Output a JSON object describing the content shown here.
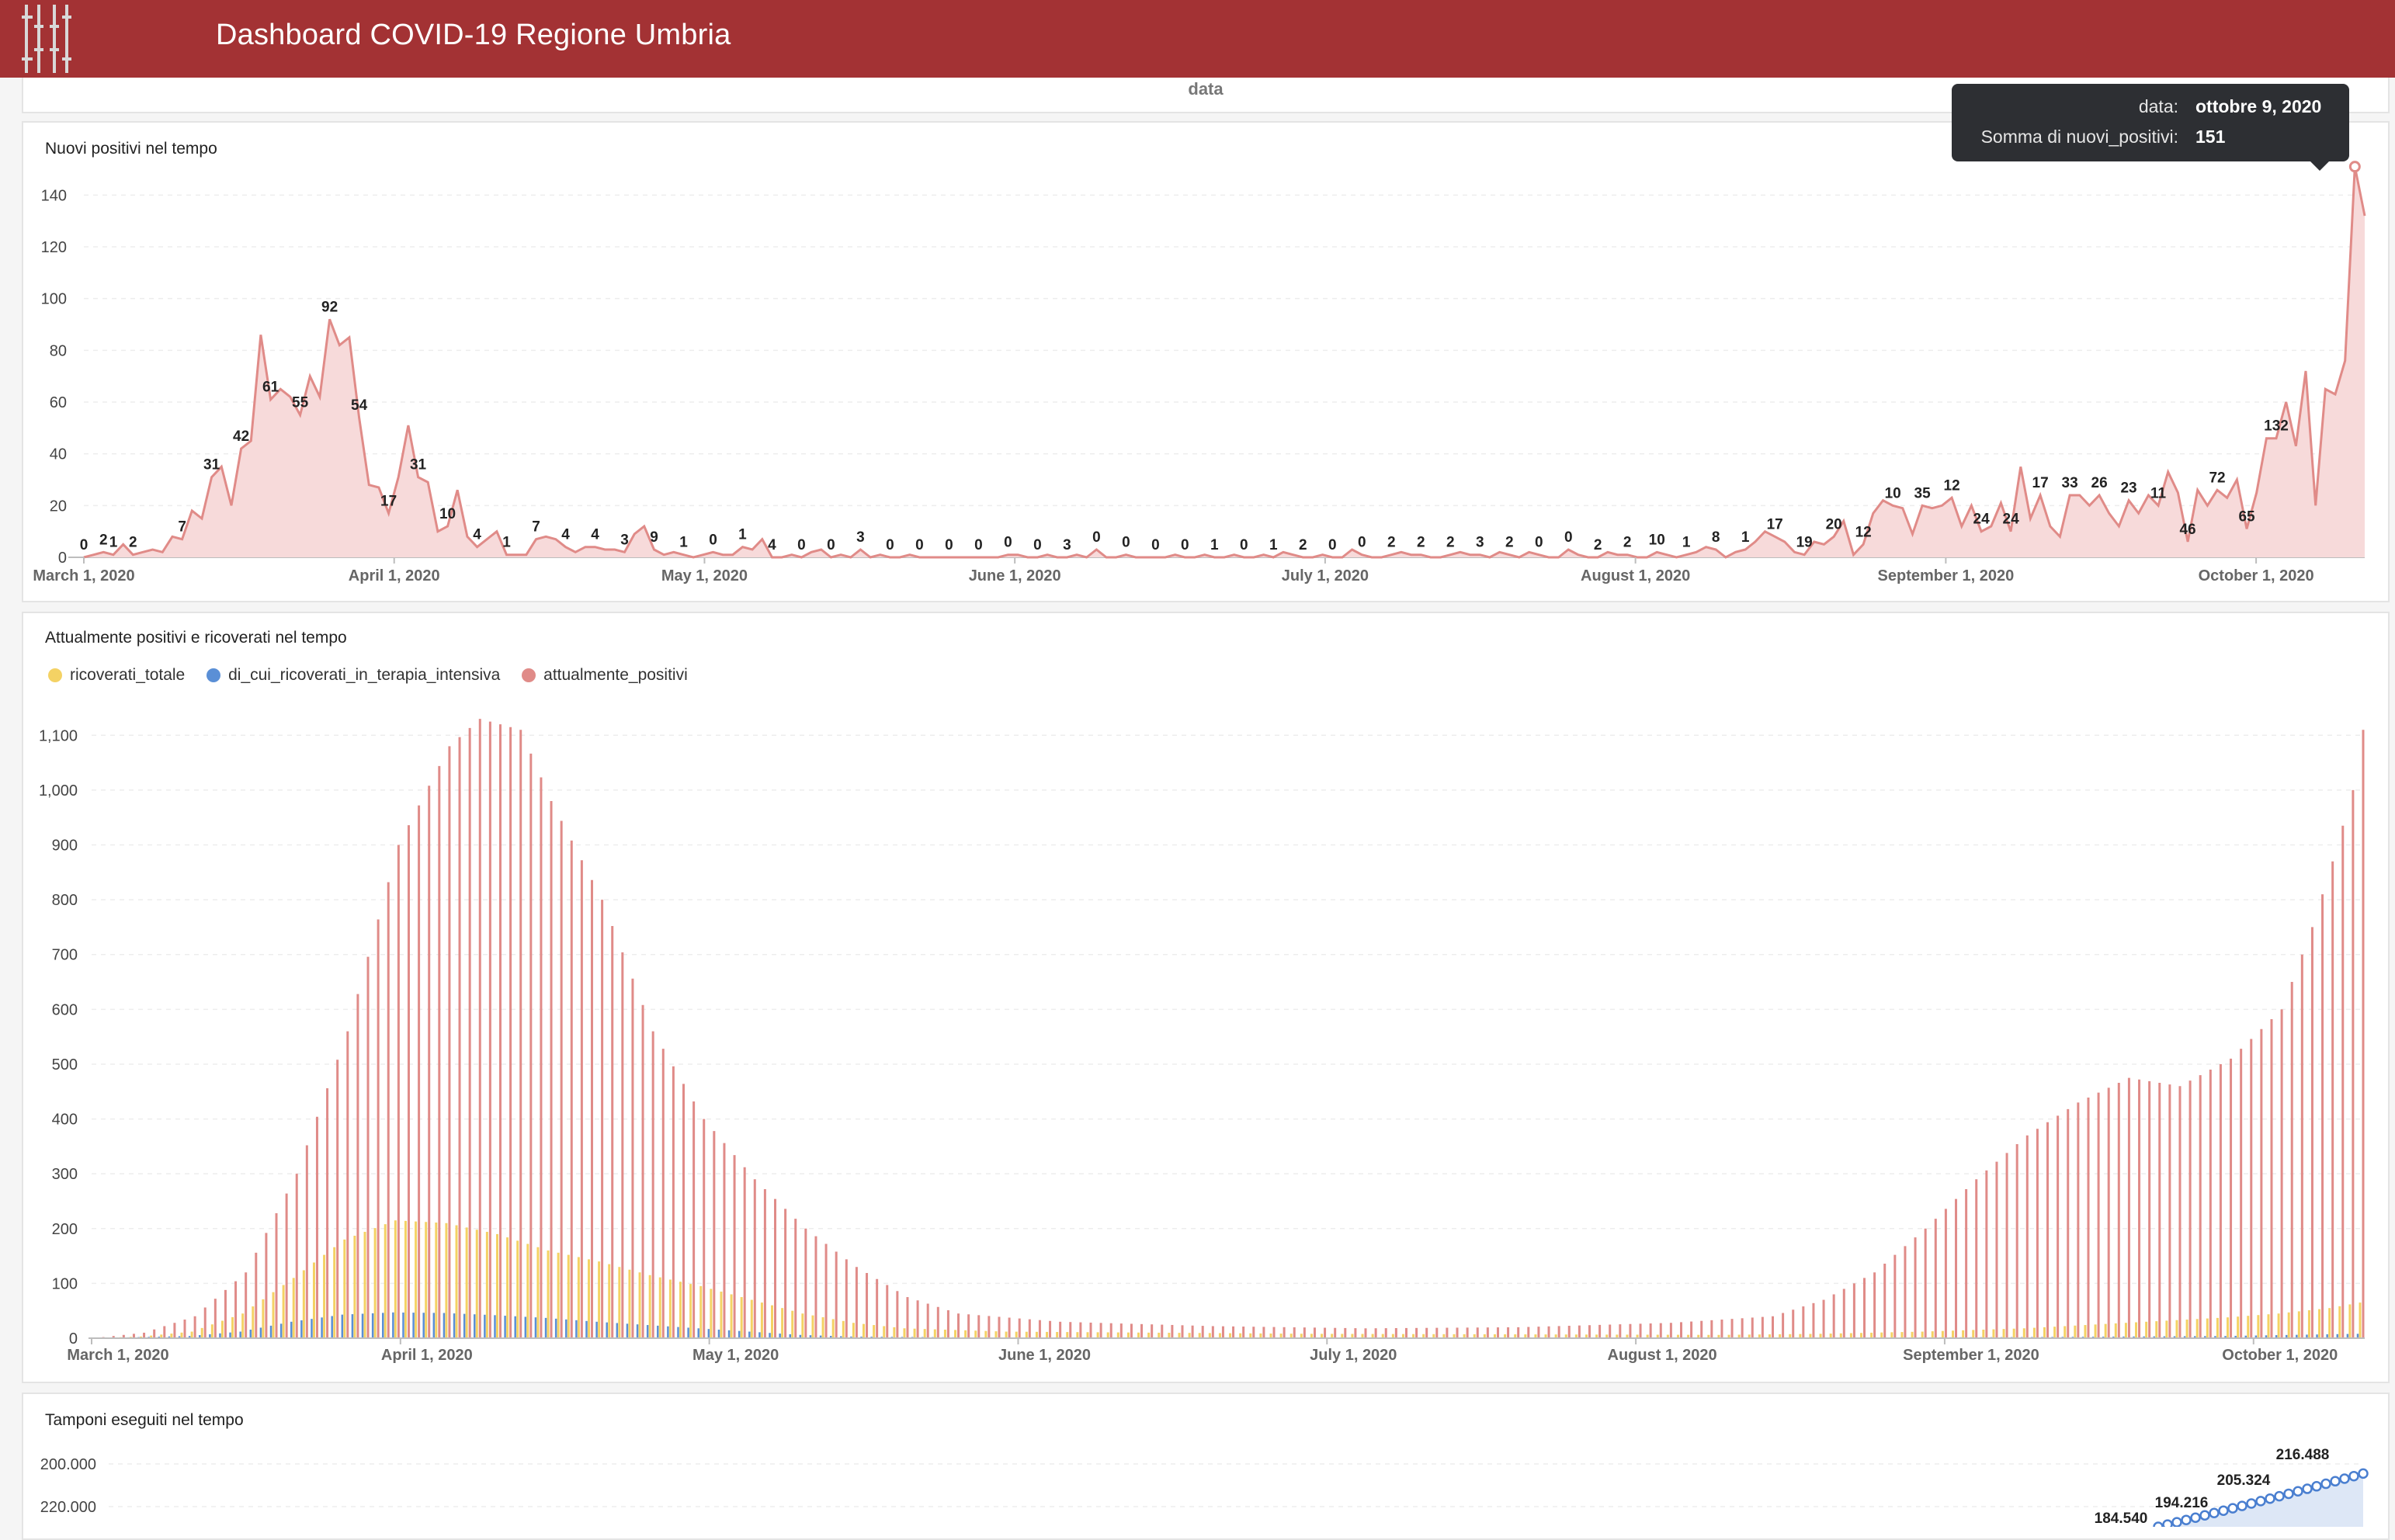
{
  "header": {
    "title": "Dashboard COVID-19 Regione Umbria",
    "logo_icon": "umbria-logo-icon"
  },
  "top_strip": {
    "axis_label": "data"
  },
  "tooltip": {
    "rows": [
      {
        "key": "data:",
        "value": "ottobre 9, 2020"
      },
      {
        "key": "Somma di nuovi_positivi:",
        "value": "151"
      }
    ]
  },
  "colors": {
    "header": "#a33234",
    "positivi": "#e08b88",
    "positivi_fill": "#f7dada",
    "ricoverati": "#f4d264",
    "terapia": "#5a8fd6",
    "tamponi": "#4a7fd0"
  },
  "panels": {
    "nuovi": {
      "title": "Nuovi positivi nel tempo"
    },
    "attuali": {
      "title": "Attualmente positivi e ricoverati nel tempo"
    },
    "tamponi": {
      "title": "Tamponi eseguiti nel tempo"
    }
  },
  "chart_data": [
    {
      "type": "area",
      "title": "Nuovi positivi nel tempo",
      "x_ticks": [
        "March 1, 2020",
        "April 1, 2020",
        "May 1, 2020",
        "June 1, 2020",
        "July 1, 2020",
        "August 1, 2020",
        "September 1, 2020",
        "October 1, 2020"
      ],
      "y_ticks": [
        "0",
        "20",
        "40",
        "60",
        "80",
        "100",
        "120",
        "140"
      ],
      "ylim": [
        0,
        150
      ],
      "series": [
        {
          "values": [
            0,
            1,
            2,
            1,
            5,
            1,
            2,
            3,
            2,
            8,
            7,
            18,
            15,
            31,
            35,
            20,
            42,
            45,
            86,
            61,
            65,
            62,
            55,
            70,
            62,
            92,
            82,
            85,
            54,
            28,
            27,
            17,
            31,
            51,
            31,
            29,
            10,
            12,
            26,
            8,
            4,
            7,
            10,
            1,
            1,
            1,
            7,
            8,
            7,
            4,
            2,
            4,
            4,
            3,
            3,
            2,
            9,
            12,
            3,
            1,
            2,
            1,
            0,
            1,
            2,
            1,
            1,
            4,
            3,
            7,
            0,
            0,
            1,
            0,
            2,
            3,
            0,
            1,
            0,
            3,
            0,
            1,
            0,
            0,
            1,
            0,
            0,
            0,
            0,
            0,
            0,
            0,
            0,
            0,
            1,
            1,
            0,
            0,
            1,
            0,
            0,
            1,
            0,
            3,
            0,
            0,
            1,
            0,
            0,
            0,
            0,
            1,
            0,
            0,
            1,
            0,
            0,
            1,
            0,
            0,
            1,
            0,
            2,
            1,
            0,
            0,
            1,
            0,
            0,
            3,
            1,
            0,
            0,
            1,
            2,
            1,
            1,
            0,
            0,
            1,
            2,
            1,
            1,
            0,
            2,
            1,
            0,
            2,
            1,
            0,
            0,
            3,
            1,
            0,
            0,
            2,
            1,
            1,
            0,
            0,
            2,
            1,
            0,
            1,
            2,
            4,
            3,
            0,
            2,
            3,
            6,
            10,
            8,
            6,
            2,
            1,
            6,
            5,
            8,
            14,
            1,
            5,
            17,
            22,
            20,
            19,
            9,
            20,
            19,
            20,
            23,
            12,
            20,
            10,
            12,
            21,
            10,
            35,
            15,
            24,
            12,
            8,
            24,
            24,
            20,
            24,
            17,
            12,
            22,
            17,
            24,
            20,
            33,
            25,
            6,
            26,
            20,
            26,
            23,
            30,
            11,
            25,
            46,
            46,
            60,
            43,
            72,
            20,
            65,
            63,
            76,
            151,
            132
          ]
        }
      ],
      "data_labels": [
        {
          "x": 0,
          "label": "0"
        },
        {
          "x": 2,
          "label": "2"
        },
        {
          "x": 3,
          "label": "1"
        },
        {
          "x": 5,
          "label": "2"
        },
        {
          "x": 10,
          "label": "7"
        },
        {
          "x": 13,
          "label": "31"
        },
        {
          "x": 16,
          "label": "42"
        },
        {
          "x": 19,
          "label": "61"
        },
        {
          "x": 22,
          "label": "55"
        },
        {
          "x": 25,
          "label": "92"
        },
        {
          "x": 28,
          "label": "54"
        },
        {
          "x": 31,
          "label": "17"
        },
        {
          "x": 34,
          "label": "31"
        },
        {
          "x": 37,
          "label": "10"
        },
        {
          "x": 40,
          "label": "4"
        },
        {
          "x": 43,
          "label": "1"
        },
        {
          "x": 46,
          "label": "7"
        },
        {
          "x": 49,
          "label": "4"
        },
        {
          "x": 52,
          "label": "4"
        },
        {
          "x": 55,
          "label": "3"
        },
        {
          "x": 58,
          "label": "9"
        },
        {
          "x": 61,
          "label": "1"
        },
        {
          "x": 64,
          "label": "0"
        },
        {
          "x": 67,
          "label": "1"
        },
        {
          "x": 70,
          "label": "4"
        },
        {
          "x": 73,
          "label": "0"
        },
        {
          "x": 76,
          "label": "0"
        },
        {
          "x": 79,
          "label": "3"
        },
        {
          "x": 82,
          "label": "0"
        },
        {
          "x": 85,
          "label": "0"
        },
        {
          "x": 88,
          "label": "0"
        },
        {
          "x": 91,
          "label": "0"
        },
        {
          "x": 94,
          "label": "0"
        },
        {
          "x": 97,
          "label": "0"
        },
        {
          "x": 100,
          "label": "3"
        },
        {
          "x": 103,
          "label": "0"
        },
        {
          "x": 106,
          "label": "0"
        },
        {
          "x": 109,
          "label": "0"
        },
        {
          "x": 112,
          "label": "0"
        },
        {
          "x": 115,
          "label": "1"
        },
        {
          "x": 118,
          "label": "0"
        },
        {
          "x": 121,
          "label": "1"
        },
        {
          "x": 124,
          "label": "2"
        },
        {
          "x": 127,
          "label": "0"
        },
        {
          "x": 130,
          "label": "0"
        },
        {
          "x": 133,
          "label": "2"
        },
        {
          "x": 136,
          "label": "2"
        },
        {
          "x": 139,
          "label": "2"
        },
        {
          "x": 142,
          "label": "3"
        },
        {
          "x": 145,
          "label": "2"
        },
        {
          "x": 148,
          "label": "0"
        },
        {
          "x": 151,
          "label": "0"
        },
        {
          "x": 154,
          "label": "2"
        },
        {
          "x": 157,
          "label": "2"
        },
        {
          "x": 160,
          "label": "10"
        },
        {
          "x": 163,
          "label": "1"
        },
        {
          "x": 166,
          "label": "8"
        },
        {
          "x": 169,
          "label": "1"
        },
        {
          "x": 172,
          "label": "17"
        },
        {
          "x": 175,
          "label": "19"
        },
        {
          "x": 178,
          "label": "20"
        },
        {
          "x": 181,
          "label": "12"
        },
        {
          "x": 184,
          "label": "10"
        },
        {
          "x": 187,
          "label": "35"
        },
        {
          "x": 190,
          "label": "12"
        },
        {
          "x": 193,
          "label": "24"
        },
        {
          "x": 196,
          "label": "24"
        },
        {
          "x": 199,
          "label": "17"
        },
        {
          "x": 202,
          "label": "33"
        },
        {
          "x": 205,
          "label": "26"
        },
        {
          "x": 208,
          "label": "23"
        },
        {
          "x": 211,
          "label": "11"
        },
        {
          "x": 214,
          "label": "46"
        },
        {
          "x": 217,
          "label": "72"
        },
        {
          "x": 220,
          "label": "65"
        },
        {
          "x": 223,
          "label": "132"
        }
      ]
    },
    {
      "type": "bar",
      "title": "Attualmente positivi e ricoverati nel tempo",
      "x_ticks": [
        "March 1, 2020",
        "April 1, 2020",
        "May 1, 2020",
        "June 1, 2020",
        "July 1, 2020",
        "August 1, 2020",
        "September 1, 2020",
        "October 1, 2020"
      ],
      "y_ticks": [
        "0",
        "100",
        "200",
        "300",
        "400",
        "500",
        "600",
        "700",
        "800",
        "900",
        "1,000",
        "1,100"
      ],
      "ylim": [
        0,
        1150
      ],
      "legend": [
        "ricoverati_totale",
        "di_cui_ricoverati_in_terapia_intensiva",
        "attualmente_positivi"
      ],
      "legend_position": "top-left",
      "series": [
        {
          "name": "attualmente_positivi",
          "key_points": [
            [
              0,
              0
            ],
            [
              5,
              10
            ],
            [
              10,
              40
            ],
            [
              15,
              120
            ],
            [
              20,
              300
            ],
            [
              25,
              560
            ],
            [
              30,
              900
            ],
            [
              35,
              1080
            ],
            [
              38,
              1130
            ],
            [
              42,
              1110
            ],
            [
              45,
              980
            ],
            [
              50,
              800
            ],
            [
              55,
              560
            ],
            [
              60,
              400
            ],
            [
              65,
              290
            ],
            [
              70,
              200
            ],
            [
              75,
              130
            ],
            [
              80,
              75
            ],
            [
              85,
              45
            ],
            [
              95,
              30
            ],
            [
              110,
              22
            ],
            [
              125,
              18
            ],
            [
              140,
              20
            ],
            [
              155,
              28
            ],
            [
              165,
              40
            ],
            [
              170,
              70
            ],
            [
              175,
              120
            ],
            [
              180,
              200
            ],
            [
              185,
              290
            ],
            [
              190,
              370
            ],
            [
              195,
              430
            ],
            [
              200,
              475
            ],
            [
              205,
              460
            ],
            [
              210,
              510
            ],
            [
              215,
              600
            ],
            [
              218,
              750
            ],
            [
              220,
              870
            ],
            [
              222,
              1000
            ],
            [
              223,
              1110
            ]
          ]
        },
        {
          "name": "ricoverati_totale",
          "key_points": [
            [
              0,
              0
            ],
            [
              5,
              3
            ],
            [
              10,
              12
            ],
            [
              15,
              45
            ],
            [
              20,
              110
            ],
            [
              25,
              180
            ],
            [
              30,
              215
            ],
            [
              35,
              210
            ],
            [
              40,
              190
            ],
            [
              45,
              160
            ],
            [
              50,
              140
            ],
            [
              55,
              115
            ],
            [
              60,
              95
            ],
            [
              65,
              70
            ],
            [
              70,
              45
            ],
            [
              75,
              28
            ],
            [
              80,
              18
            ],
            [
              90,
              12
            ],
            [
              120,
              8
            ],
            [
              160,
              6
            ],
            [
              170,
              8
            ],
            [
              180,
              12
            ],
            [
              190,
              18
            ],
            [
              200,
              28
            ],
            [
              210,
              38
            ],
            [
              215,
              45
            ],
            [
              220,
              55
            ],
            [
              223,
              65
            ]
          ]
        },
        {
          "name": "di_cui_ricoverati_in_terapia_intensiva",
          "key_points": [
            [
              0,
              0
            ],
            [
              10,
              4
            ],
            [
              15,
              12
            ],
            [
              20,
              30
            ],
            [
              25,
              43
            ],
            [
              30,
              47
            ],
            [
              35,
              46
            ],
            [
              40,
              42
            ],
            [
              45,
              37
            ],
            [
              50,
              30
            ],
            [
              55,
              24
            ],
            [
              60,
              18
            ],
            [
              65,
              12
            ],
            [
              70,
              6
            ],
            [
              75,
              3
            ],
            [
              90,
              1
            ],
            [
              170,
              1
            ],
            [
              190,
              2
            ],
            [
              210,
              4
            ],
            [
              223,
              8
            ]
          ]
        }
      ]
    },
    {
      "type": "line",
      "title": "Tamponi eseguiti nel tempo",
      "y_ticks": [
        "200.000",
        "220.000"
      ],
      "data_labels": [
        "184.540",
        "194.216",
        "205.324",
        "216.488"
      ]
    }
  ]
}
